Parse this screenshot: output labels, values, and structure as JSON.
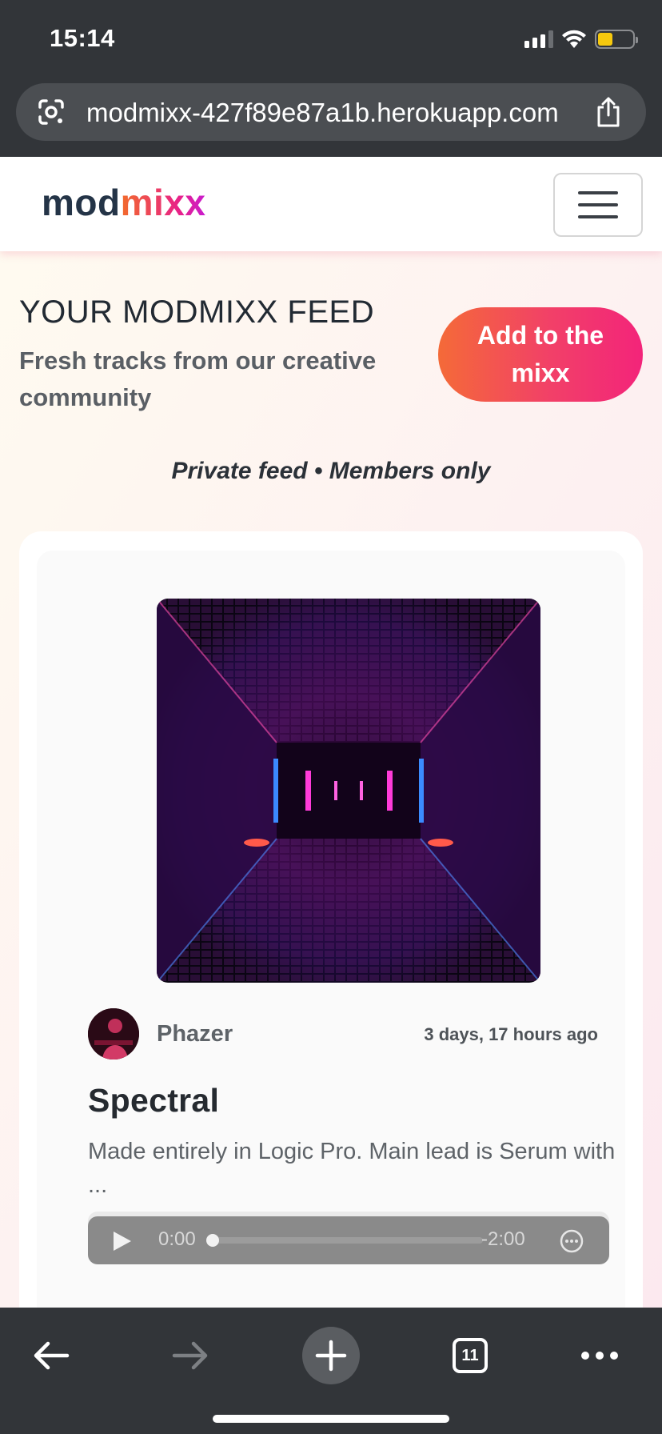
{
  "status_bar": {
    "time": "15:14",
    "icons": [
      "signal-icon",
      "wifi-icon",
      "battery-icon"
    ],
    "battery_color": "#f6c90e"
  },
  "browser": {
    "url": "modmixx-427f89e87a1b.herokuapp.com",
    "toolbar": {
      "tab_count": "11",
      "icons": [
        "back-arrow-icon",
        "forward-arrow-icon",
        "plus-icon",
        "tabs-icon",
        "more-icon"
      ]
    }
  },
  "navbar": {
    "brand_part1": "mod",
    "brand_part2": "mixx",
    "brand_color": "#243447",
    "brand_gradient": [
      "#f26b2b",
      "#e8208a",
      "#c81ccf"
    ]
  },
  "feed": {
    "title": "YOUR MODMIXX FEED",
    "subtitle": "Fresh tracks from our creative community",
    "add_button": "Add to the mixx",
    "note": "Private feed • Members only"
  },
  "track": {
    "artist": "Phazer",
    "posted": "3 days, 17 hours ago",
    "title": "Spectral",
    "description": "Made entirely in Logic Pro. Main lead is Serum with ...",
    "player": {
      "current_time": "0:00",
      "remaining_time": "-2:00",
      "progress": 0
    }
  },
  "colors": {
    "chrome": "#323539",
    "accent_start": "#f46a38",
    "accent_end": "#f3247a"
  }
}
